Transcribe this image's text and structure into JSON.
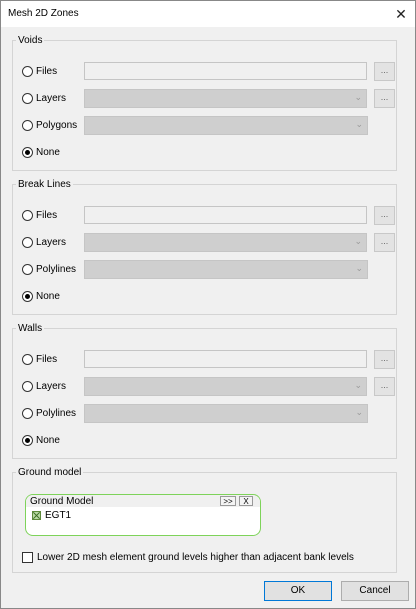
{
  "window": {
    "title": "Mesh 2D Zones",
    "close_glyph": "✕"
  },
  "voids": {
    "legend": "Voids",
    "options": [
      "Files",
      "Layers",
      "Polygons",
      "None"
    ],
    "selected": "None",
    "files_value": "",
    "browse_label": "..."
  },
  "break_lines": {
    "legend": "Break Lines",
    "options": [
      "Files",
      "Layers",
      "Polylines",
      "None"
    ],
    "selected": "None",
    "files_value": "",
    "browse_label": "..."
  },
  "walls": {
    "legend": "Walls",
    "options": [
      "Files",
      "Layers",
      "Polylines",
      "None"
    ],
    "selected": "None",
    "files_value": "",
    "browse_label": "..."
  },
  "ground_model": {
    "legend": "Ground model",
    "panel_title": "Ground Model",
    "expand_label": ">>",
    "remove_label": "X",
    "items": [
      "EGT1"
    ],
    "item_icon": "tin-surface-icon",
    "checkbox_label": "Lower 2D mesh element ground levels higher than adjacent bank levels",
    "checkbox_checked": false
  },
  "footer": {
    "ok_label": "OK",
    "cancel_label": "Cancel"
  },
  "colors": {
    "panel_border": "#7ed35a",
    "default_button_border": "#0078d7"
  }
}
